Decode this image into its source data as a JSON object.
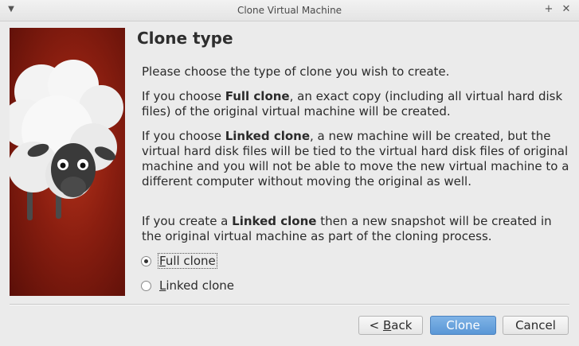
{
  "window": {
    "title": "Clone Virtual Machine",
    "menu_icon": "chevron-down-icon",
    "maximize_icon": "plus-icon",
    "close_icon": "close-icon"
  },
  "content": {
    "heading": "Clone type",
    "intro": "Please choose the type of clone you wish to create.",
    "full_clone_para": {
      "pre": "If you choose ",
      "bold": "Full clone",
      "post": ", an exact copy (including all virtual hard disk files) of the original virtual machine will be created."
    },
    "linked_clone_para": {
      "pre": "If you choose ",
      "bold": "Linked clone",
      "post": ", a new machine will be created, but the virtual hard disk files will be tied to the virtual hard disk files of original machine and you will not be able to move the new virtual machine to a different computer without moving the original as well."
    },
    "snapshot_para": {
      "pre": "If you create a ",
      "bold": "Linked clone",
      "post": " then a new snapshot will be created in the original virtual machine as part of the cloning process."
    }
  },
  "options": {
    "full_clone": {
      "label_first": "F",
      "label_rest": "ull clone",
      "checked": true
    },
    "linked_clone": {
      "label_first": "L",
      "label_rest": "inked clone",
      "checked": false
    }
  },
  "buttons": {
    "back": {
      "prefix": "< ",
      "mnemonic": "B",
      "rest": "ack"
    },
    "clone": "Clone",
    "cancel": "Cancel"
  },
  "colors": {
    "banner_red": "#8a1e10",
    "accent_blue": "#5a97d6"
  }
}
